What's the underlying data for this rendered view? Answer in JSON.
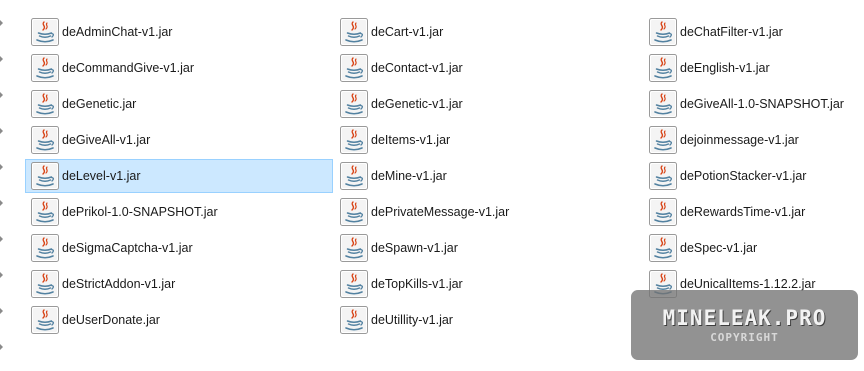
{
  "files": [
    {
      "name": "deAdminChat-v1.jar",
      "selected": false
    },
    {
      "name": "deCart-v1.jar",
      "selected": false
    },
    {
      "name": "deChatFilter-v1.jar",
      "selected": false
    },
    {
      "name": "deCommandGive-v1.jar",
      "selected": false
    },
    {
      "name": "deContact-v1.jar",
      "selected": false
    },
    {
      "name": "deEnglish-v1.jar",
      "selected": false
    },
    {
      "name": "deGenetic.jar",
      "selected": false
    },
    {
      "name": "deGenetic-v1.jar",
      "selected": false
    },
    {
      "name": "deGiveAll-1.0-SNAPSHOT.jar",
      "selected": false
    },
    {
      "name": "deGiveAll-v1.jar",
      "selected": false
    },
    {
      "name": "deItems-v1.jar",
      "selected": false
    },
    {
      "name": "dejoinmessage-v1.jar",
      "selected": false
    },
    {
      "name": "deLevel-v1.jar",
      "selected": true
    },
    {
      "name": "deMine-v1.jar",
      "selected": false
    },
    {
      "name": "dePotionStacker-v1.jar",
      "selected": false
    },
    {
      "name": "dePrikol-1.0-SNAPSHOT.jar",
      "selected": false
    },
    {
      "name": "dePrivateMessage-v1.jar",
      "selected": false
    },
    {
      "name": "deRewardsTime-v1.jar",
      "selected": false
    },
    {
      "name": "deSigmaCaptcha-v1.jar",
      "selected": false
    },
    {
      "name": "deSpawn-v1.jar",
      "selected": false
    },
    {
      "name": "deSpec-v1.jar",
      "selected": false
    },
    {
      "name": "deStrictAddon-v1.jar",
      "selected": false
    },
    {
      "name": "deTopKills-v1.jar",
      "selected": false
    },
    {
      "name": "deUnicalItems-1.12.2.jar",
      "selected": false
    },
    {
      "name": "deUserDonate.jar",
      "selected": false
    },
    {
      "name": "deUtillity-v1.jar",
      "selected": false
    }
  ],
  "file_icon": "java-jar-icon",
  "colors": {
    "selection_bg": "#cce8ff",
    "selection_border": "#99d1ff",
    "java_cup_red": "#d84315",
    "java_cup_blue": "#5382a1"
  },
  "watermark": {
    "title": "MINELEAK.PRO",
    "subtitle": "COPYRIGHT"
  }
}
